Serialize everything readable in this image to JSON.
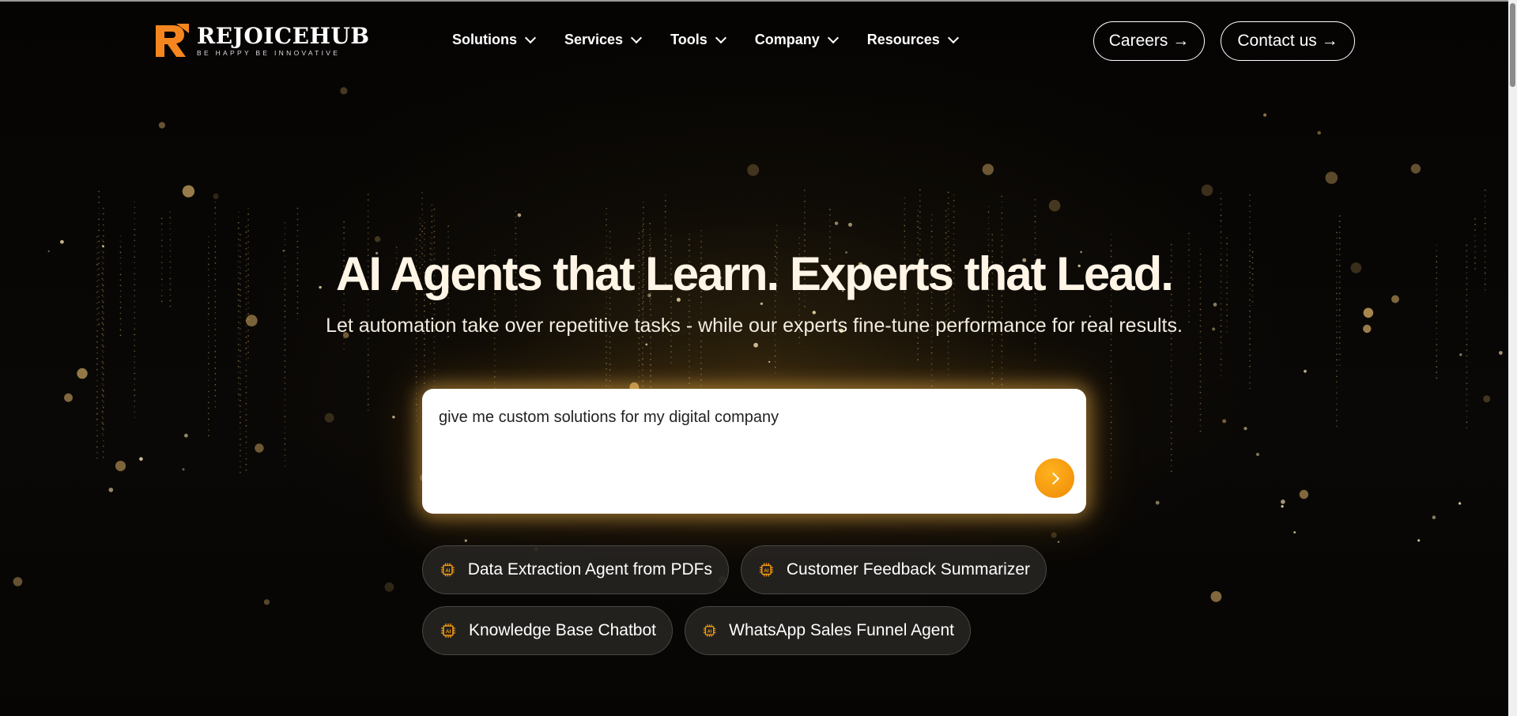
{
  "header": {
    "logo": {
      "name": "REJOICEHUB",
      "tagline": "BE HAPPY BE INNOVATIVE"
    },
    "nav": [
      {
        "label": "Solutions"
      },
      {
        "label": "Services"
      },
      {
        "label": "Tools"
      },
      {
        "label": "Company"
      },
      {
        "label": "Resources"
      }
    ],
    "careers_label": "Careers →",
    "contact_label": "Contact us →"
  },
  "hero": {
    "headline": "AI Agents that Learn. Experts that Lead.",
    "subline": "Let automation take over repetitive tasks - while our experts fine-tune performance for real results.",
    "prompt_value": "give me custom solutions for my digital company"
  },
  "chips": [
    {
      "label": "Data Extraction Agent from PDFs",
      "icon": "ai-chip-icon"
    },
    {
      "label": "Customer Feedback Summarizer",
      "icon": "ai-chip-icon"
    },
    {
      "label": "Knowledge Base Chatbot",
      "icon": "ai-chip-icon"
    },
    {
      "label": "WhatsApp Sales Funnel Agent",
      "icon": "ai-chip-icon"
    }
  ],
  "colors": {
    "accent": "#f39a10",
    "background": "#070604",
    "glow": "#ffbe50"
  }
}
